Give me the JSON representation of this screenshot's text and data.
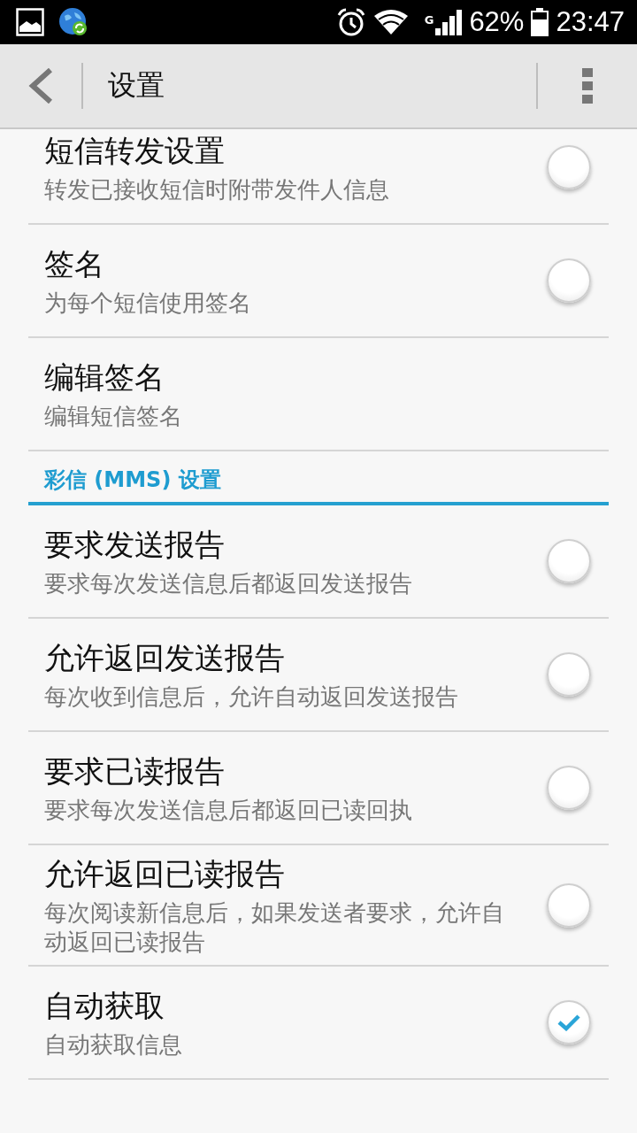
{
  "status_bar": {
    "network_type": "G",
    "battery_percent": "62%",
    "time": "23:47"
  },
  "toolbar": {
    "title": "设置"
  },
  "sections": [
    {
      "items": [
        {
          "title": "短信转发设置",
          "subtitle": "转发已接收短信时附带发件人信息",
          "kind": "checkbox",
          "checked": false
        },
        {
          "title": "签名",
          "subtitle": "为每个短信使用签名",
          "kind": "checkbox",
          "checked": false
        },
        {
          "title": "编辑签名",
          "subtitle": "编辑短信签名",
          "kind": "link"
        }
      ]
    },
    {
      "header": "彩信 (MMS) 设置",
      "items": [
        {
          "title": "要求发送报告",
          "subtitle": "要求每次发送信息后都返回发送报告",
          "kind": "checkbox",
          "checked": false
        },
        {
          "title": "允许返回发送报告",
          "subtitle": "每次收到信息后，允许自动返回发送报告",
          "kind": "checkbox",
          "checked": false
        },
        {
          "title": "要求已读报告",
          "subtitle": "要求每次发送信息后都返回已读回执",
          "kind": "checkbox",
          "checked": false
        },
        {
          "title": "允许返回已读报告",
          "subtitle": "每次阅读新信息后，如果发送者要求，允许自动返回已读报告",
          "kind": "checkbox",
          "checked": false
        },
        {
          "title": "自动获取",
          "subtitle": "自动获取信息",
          "kind": "checkbox",
          "checked": true
        }
      ]
    }
  ]
}
